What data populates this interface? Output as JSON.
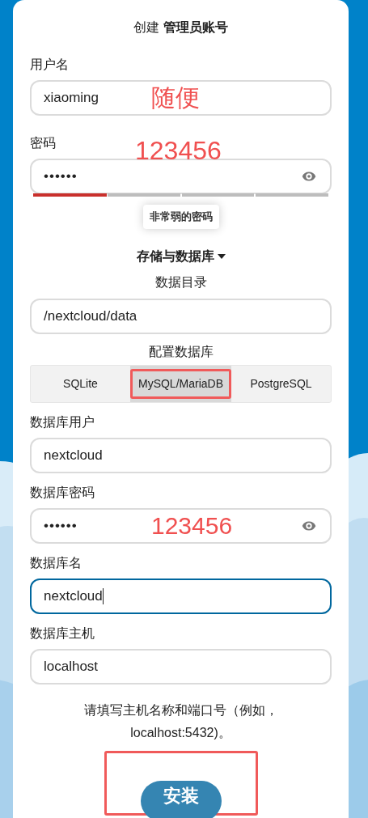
{
  "title": {
    "prefix": "创建",
    "bold": "管理员账号"
  },
  "admin_fields": [
    {
      "label": "用户名",
      "value": "xiaoming",
      "kind": "text",
      "annotation": "随便",
      "annotation_above": false
    },
    {
      "label": "密码",
      "value": "••••••",
      "kind": "password",
      "annotation": "123456",
      "annotation_above": true
    }
  ],
  "password_strength": {
    "level": 0.25,
    "tooltip": "非常弱的密码"
  },
  "storage_toggle": {
    "label": "存储与数据库",
    "expanded": true
  },
  "data_dir": {
    "label": "数据目录",
    "value": "/nextcloud/data"
  },
  "db_config": {
    "label": "配置数据库",
    "tabs": [
      {
        "label": "SQLite",
        "selected": false,
        "highlighted": false
      },
      {
        "label": "MySQL/MariaDB",
        "selected": true,
        "highlighted": true
      },
      {
        "label": "PostgreSQL",
        "selected": false,
        "highlighted": false
      }
    ]
  },
  "db_fields": [
    {
      "label": "数据库用户",
      "value": "nextcloud",
      "kind": "text",
      "focused": false
    },
    {
      "label": "数据库密码",
      "value": "••••••",
      "kind": "password",
      "focused": false,
      "annotation": "123456",
      "annotation_above": false
    },
    {
      "label": "数据库名",
      "value": "nextcloud",
      "kind": "text",
      "focused": true
    },
    {
      "label": "数据库主机",
      "value": "localhost",
      "kind": "text",
      "focused": false
    }
  ],
  "hint": [
    "请填写主机名称和端口号（例如，",
    "localhost:5432)。"
  ],
  "install_button": {
    "label": "安装",
    "highlighted": true
  }
}
